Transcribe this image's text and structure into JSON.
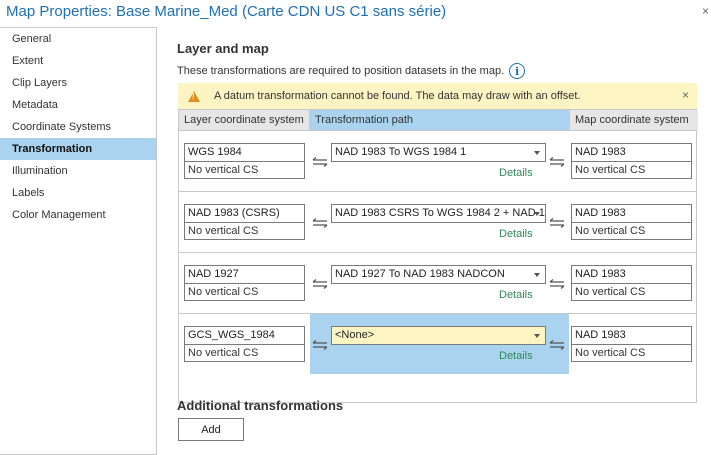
{
  "window": {
    "title": "Map Properties: Base Marine_Med (Carte CDN US C1 sans série)",
    "close_glyph": "×"
  },
  "sidebar": {
    "items": [
      {
        "label": "General",
        "active": false
      },
      {
        "label": "Extent",
        "active": false
      },
      {
        "label": "Clip Layers",
        "active": false
      },
      {
        "label": "Metadata",
        "active": false
      },
      {
        "label": "Coordinate Systems",
        "active": false
      },
      {
        "label": "Transformation",
        "active": true
      },
      {
        "label": "Illumination",
        "active": false
      },
      {
        "label": "Labels",
        "active": false
      },
      {
        "label": "Color Management",
        "active": false
      }
    ]
  },
  "main": {
    "heading": "Layer and map",
    "description": "These transformations are required to position datasets in the map.",
    "info_glyph": "i",
    "warning": {
      "text": "A datum transformation cannot be found. The data may draw with an offset.",
      "dismiss_glyph": "×"
    },
    "table": {
      "headers": [
        "Layer coordinate system",
        "Transformation path",
        "Map coordinate system"
      ],
      "rows": [
        {
          "layer_cs": "WGS 1984",
          "layer_vcs": "No vertical CS",
          "path": "NAD 1983 To WGS 1984 1",
          "details": "Details",
          "map_cs": "NAD 1983",
          "map_vcs": "No vertical CS"
        },
        {
          "layer_cs": "NAD 1983 (CSRS)",
          "layer_vcs": "No vertical CS",
          "path": "NAD 1983 CSRS To WGS 1984 2 + NAD 1",
          "details": "Details",
          "map_cs": "NAD 1983",
          "map_vcs": "No vertical CS"
        },
        {
          "layer_cs": "NAD 1927",
          "layer_vcs": "No vertical CS",
          "path": "NAD 1927 To NAD 1983 NADCON",
          "details": "Details",
          "map_cs": "NAD 1983",
          "map_vcs": "No vertical CS"
        },
        {
          "layer_cs": "GCS_WGS_1984",
          "layer_vcs": "No vertical CS",
          "path": "<None>",
          "details": "Details",
          "map_cs": "NAD 1983",
          "map_vcs": "No vertical CS"
        }
      ]
    },
    "additional": {
      "heading": "Additional transformations",
      "add_label": "Add"
    }
  },
  "colors": {
    "title_blue": "#1f6fb5",
    "selection_blue": "#a9d3ee",
    "warning_bg": "#fdf4c3",
    "warning_icon": "#e0901e",
    "details_green": "#2e8b57"
  }
}
